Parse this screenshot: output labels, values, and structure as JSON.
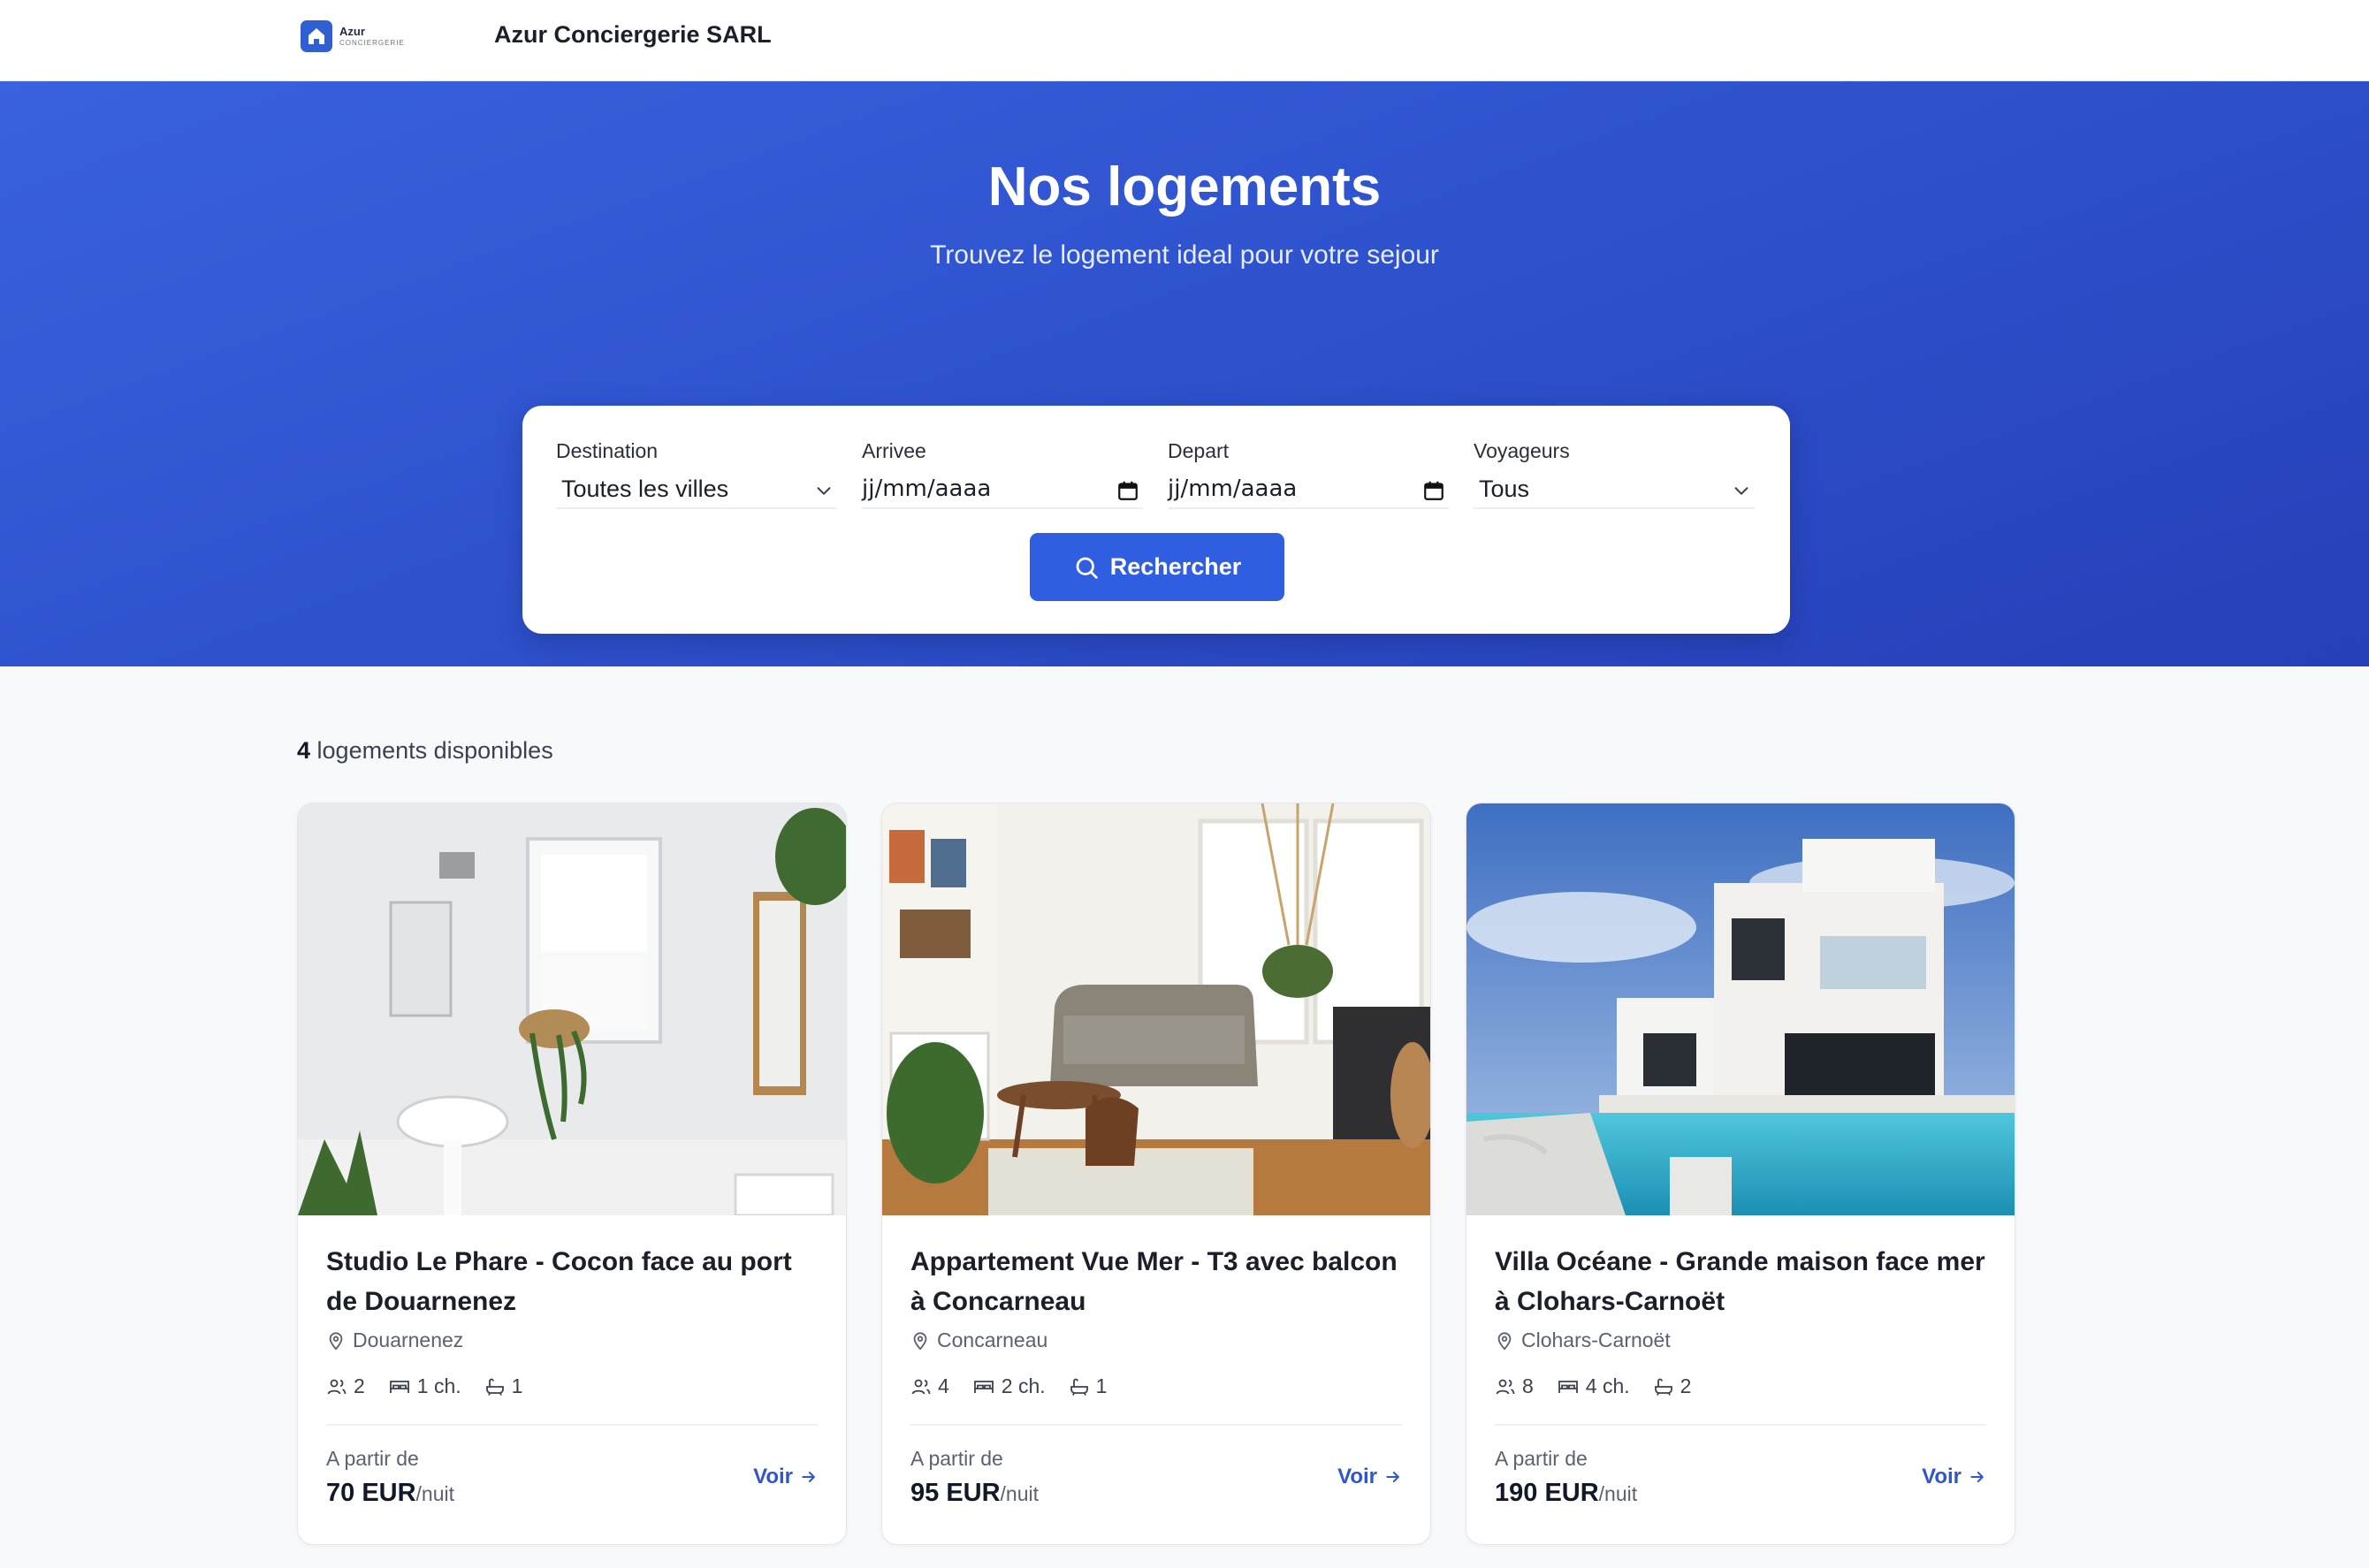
{
  "header": {
    "logo_line1": "Azur",
    "logo_line2": "CONCIERGERIE",
    "company": "Azur Conciergerie SARL"
  },
  "hero": {
    "title": "Nos logements",
    "subtitle": "Trouvez le logement ideal pour votre sejour"
  },
  "search": {
    "destination_label": "Destination",
    "destination_value": "Toutes les villes",
    "arrival_label": "Arrivee",
    "arrival_placeholder": "jj/mm/aaaa",
    "departure_label": "Depart",
    "departure_placeholder": "jj/mm/aaaa",
    "guests_label": "Voyageurs",
    "guests_value": "Tous",
    "button_label": "Rechercher"
  },
  "results": {
    "count": "4",
    "count_suffix": " logements disponibles"
  },
  "listings": [
    {
      "title": "Studio Le Phare - Cocon face au port de Douarnenez",
      "city": "Douarnenez",
      "guests": "2",
      "bedrooms": "1 ch.",
      "bathrooms": "1",
      "price_from": "A partir de",
      "price": "70 EUR",
      "price_unit": "/nuit",
      "cta": "Voir"
    },
    {
      "title": "Appartement Vue Mer - T3 avec balcon à Concarneau",
      "city": "Concarneau",
      "guests": "4",
      "bedrooms": "2 ch.",
      "bathrooms": "1",
      "price_from": "A partir de",
      "price": "95 EUR",
      "price_unit": "/nuit",
      "cta": "Voir"
    },
    {
      "title": "Villa Océane - Grande maison face mer à Clohars-Carnoët",
      "city": "Clohars-Carnoët",
      "guests": "8",
      "bedrooms": "4 ch.",
      "bathrooms": "2",
      "price_from": "A partir de",
      "price": "190 EUR",
      "price_unit": "/nuit",
      "cta": "Voir"
    }
  ],
  "colors": {
    "brand": "#2f5fe0",
    "hero_start": "#3a61de",
    "hero_end": "#2540b8",
    "link": "#2f56cc"
  }
}
